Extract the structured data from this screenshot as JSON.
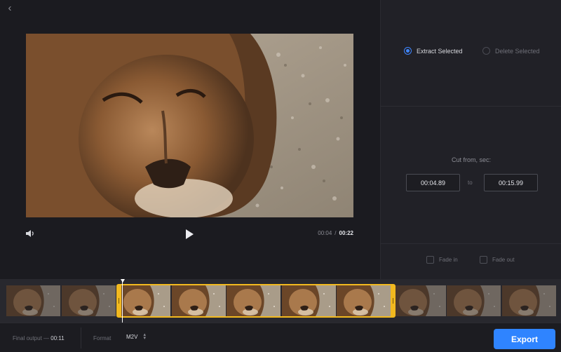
{
  "player": {
    "current_time": "00:04",
    "separator": "/",
    "duration": "00:22",
    "icons": {
      "back": "chevron-left-icon",
      "volume": "volume-icon",
      "play": "play-icon"
    }
  },
  "mode": {
    "extract_label": "Extract Selected",
    "delete_label": "Delete Selected",
    "selected": "extract"
  },
  "cut": {
    "label": "Cut from, sec:",
    "from": "00:04.89",
    "to_label": "to",
    "to": "00:15.99"
  },
  "fades": {
    "fade_in_label": "Fade in",
    "fade_out_label": "Fade out",
    "fade_in": false,
    "fade_out": false
  },
  "timeline": {
    "thumbnail_count": 10,
    "selected_thumbnails": [
      2,
      3,
      4,
      5,
      6
    ],
    "selection_color": "#f2b91f"
  },
  "footer": {
    "final_output_label": "Final output —",
    "final_output_value": "00:11",
    "format_label": "Format",
    "format_value": "M2V",
    "export_label": "Export"
  },
  "colors": {
    "accent": "#2f84ff",
    "selection": "#f2b91f"
  }
}
